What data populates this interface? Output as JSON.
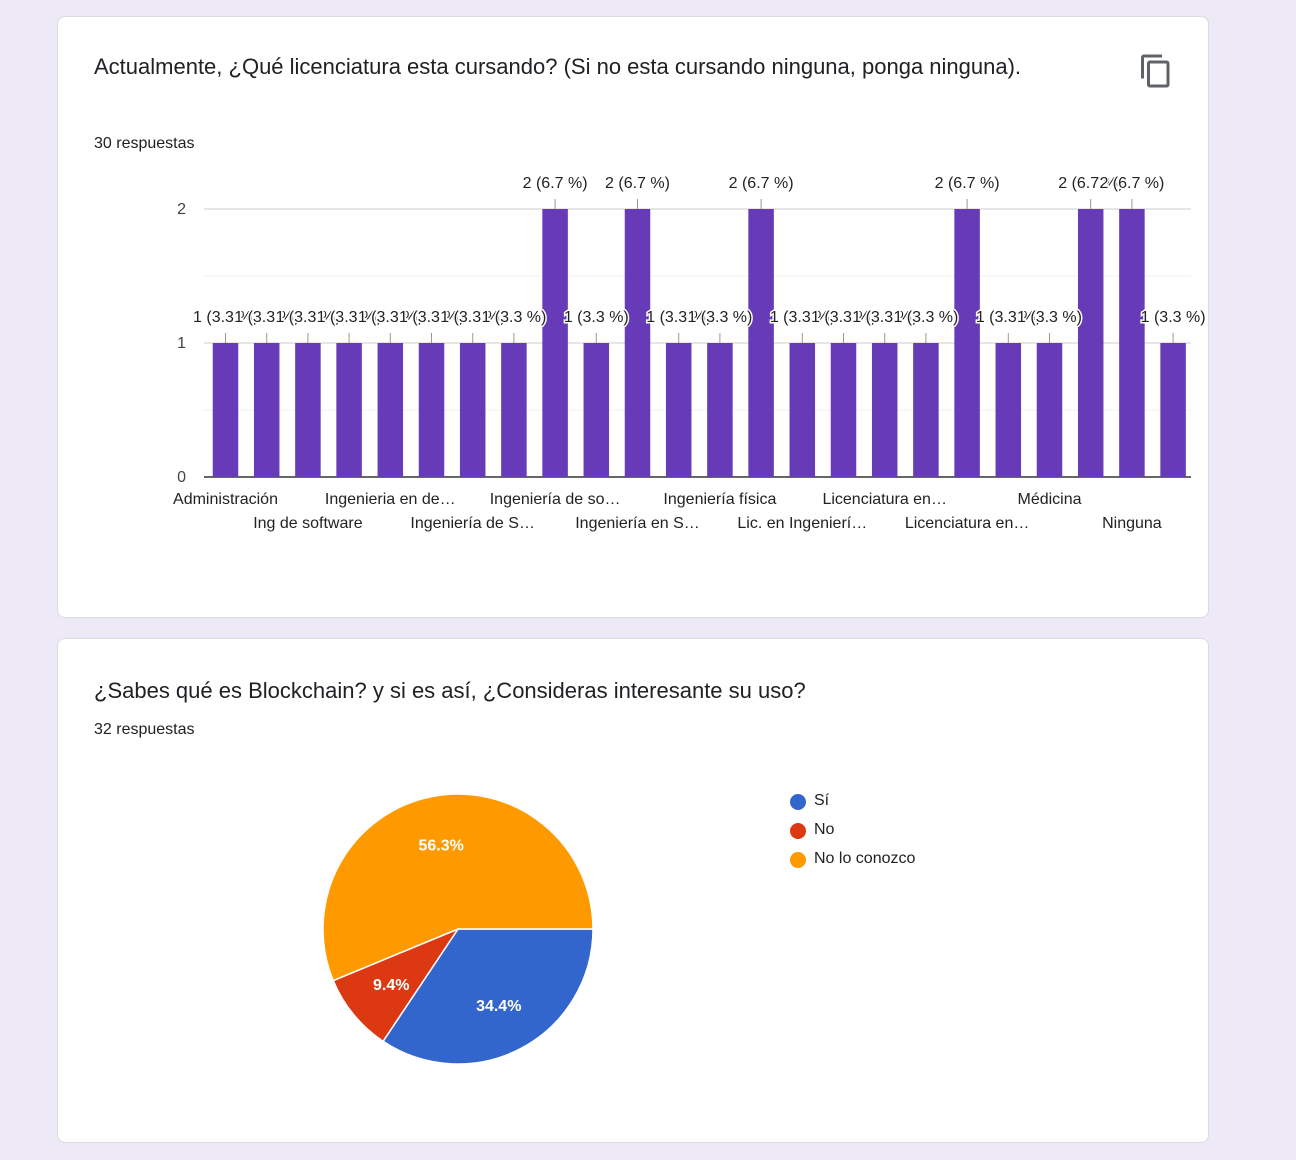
{
  "q1": {
    "title": "Actualmente, ¿Qué licenciatura esta cursando? (Si no esta cursando ninguna, ponga ninguna).",
    "responses": "30 respuestas",
    "copy_icon": "copy-icon"
  },
  "q2": {
    "title": "¿Sabes qué es Blockchain? y si es así, ¿Consideras interesante su uso?",
    "responses": "32 respuestas"
  },
  "chart_data": [
    {
      "type": "bar",
      "title": "",
      "xlabel": "",
      "ylabel": "",
      "ylim": [
        0,
        2
      ],
      "yticks": [
        0,
        1,
        2
      ],
      "grid": true,
      "color": "#673ab7",
      "values": [
        1,
        1,
        1,
        1,
        1,
        1,
        1,
        1,
        2,
        1,
        2,
        1,
        1,
        2,
        1,
        1,
        1,
        1,
        2,
        1,
        1,
        2,
        2,
        1
      ],
      "data_labels": [
        "1 (3.3 %)",
        "1 (3.3 %)",
        "1 (3.3 %)",
        "1 (3.3 %)",
        "1 (3.3 %)",
        "1 (3.3 %)",
        "1 (3.3 %)",
        "1 (3.3 %)",
        "2 (6.7 %)",
        "1 (3.3 %)",
        "2 (6.7 %)",
        "1 (3.3 %)",
        "1 (3.3 %)",
        "2 (6.7 %)",
        "1 (3.3 %)",
        "1 (3.3 %)",
        "1 (3.3 %)",
        "1 (3.3 %)",
        "2 (6.7 %)",
        "1 (3.3 %)",
        "1 (3.3 %)",
        "2 (6.7 %)",
        "2 (6.7 %)",
        "1 (3.3 %)"
      ],
      "tick_labels": [
        {
          "bar": 0,
          "row": 0,
          "text": "Administración"
        },
        {
          "bar": 2,
          "row": 1,
          "text": "Ing de software"
        },
        {
          "bar": 4,
          "row": 0,
          "text": "Ingenieria en de…"
        },
        {
          "bar": 6,
          "row": 1,
          "text": "Ingeniería de S…"
        },
        {
          "bar": 8,
          "row": 0,
          "text": "Ingeniería de so…"
        },
        {
          "bar": 10,
          "row": 1,
          "text": "Ingeniería en S…"
        },
        {
          "bar": 12,
          "row": 0,
          "text": "Ingeniería física"
        },
        {
          "bar": 14,
          "row": 1,
          "text": "Lic. en Ingenierí…"
        },
        {
          "bar": 16,
          "row": 0,
          "text": "Licenciatura en…"
        },
        {
          "bar": 18,
          "row": 1,
          "text": "Licenciatura en…"
        },
        {
          "bar": 20,
          "row": 0,
          "text": "Médicina"
        },
        {
          "bar": 22,
          "row": 1,
          "text": "Ninguna"
        }
      ]
    },
    {
      "type": "pie",
      "slices": [
        {
          "name": "Sí",
          "value": 34.4,
          "label": "34.4%",
          "color": "#3366cc"
        },
        {
          "name": "No",
          "value": 9.4,
          "label": "9.4%",
          "color": "#dc3912"
        },
        {
          "name": "No lo conozco",
          "value": 56.3,
          "label": "56.3%",
          "color": "#ff9900"
        }
      ],
      "legend_position": "right"
    }
  ]
}
